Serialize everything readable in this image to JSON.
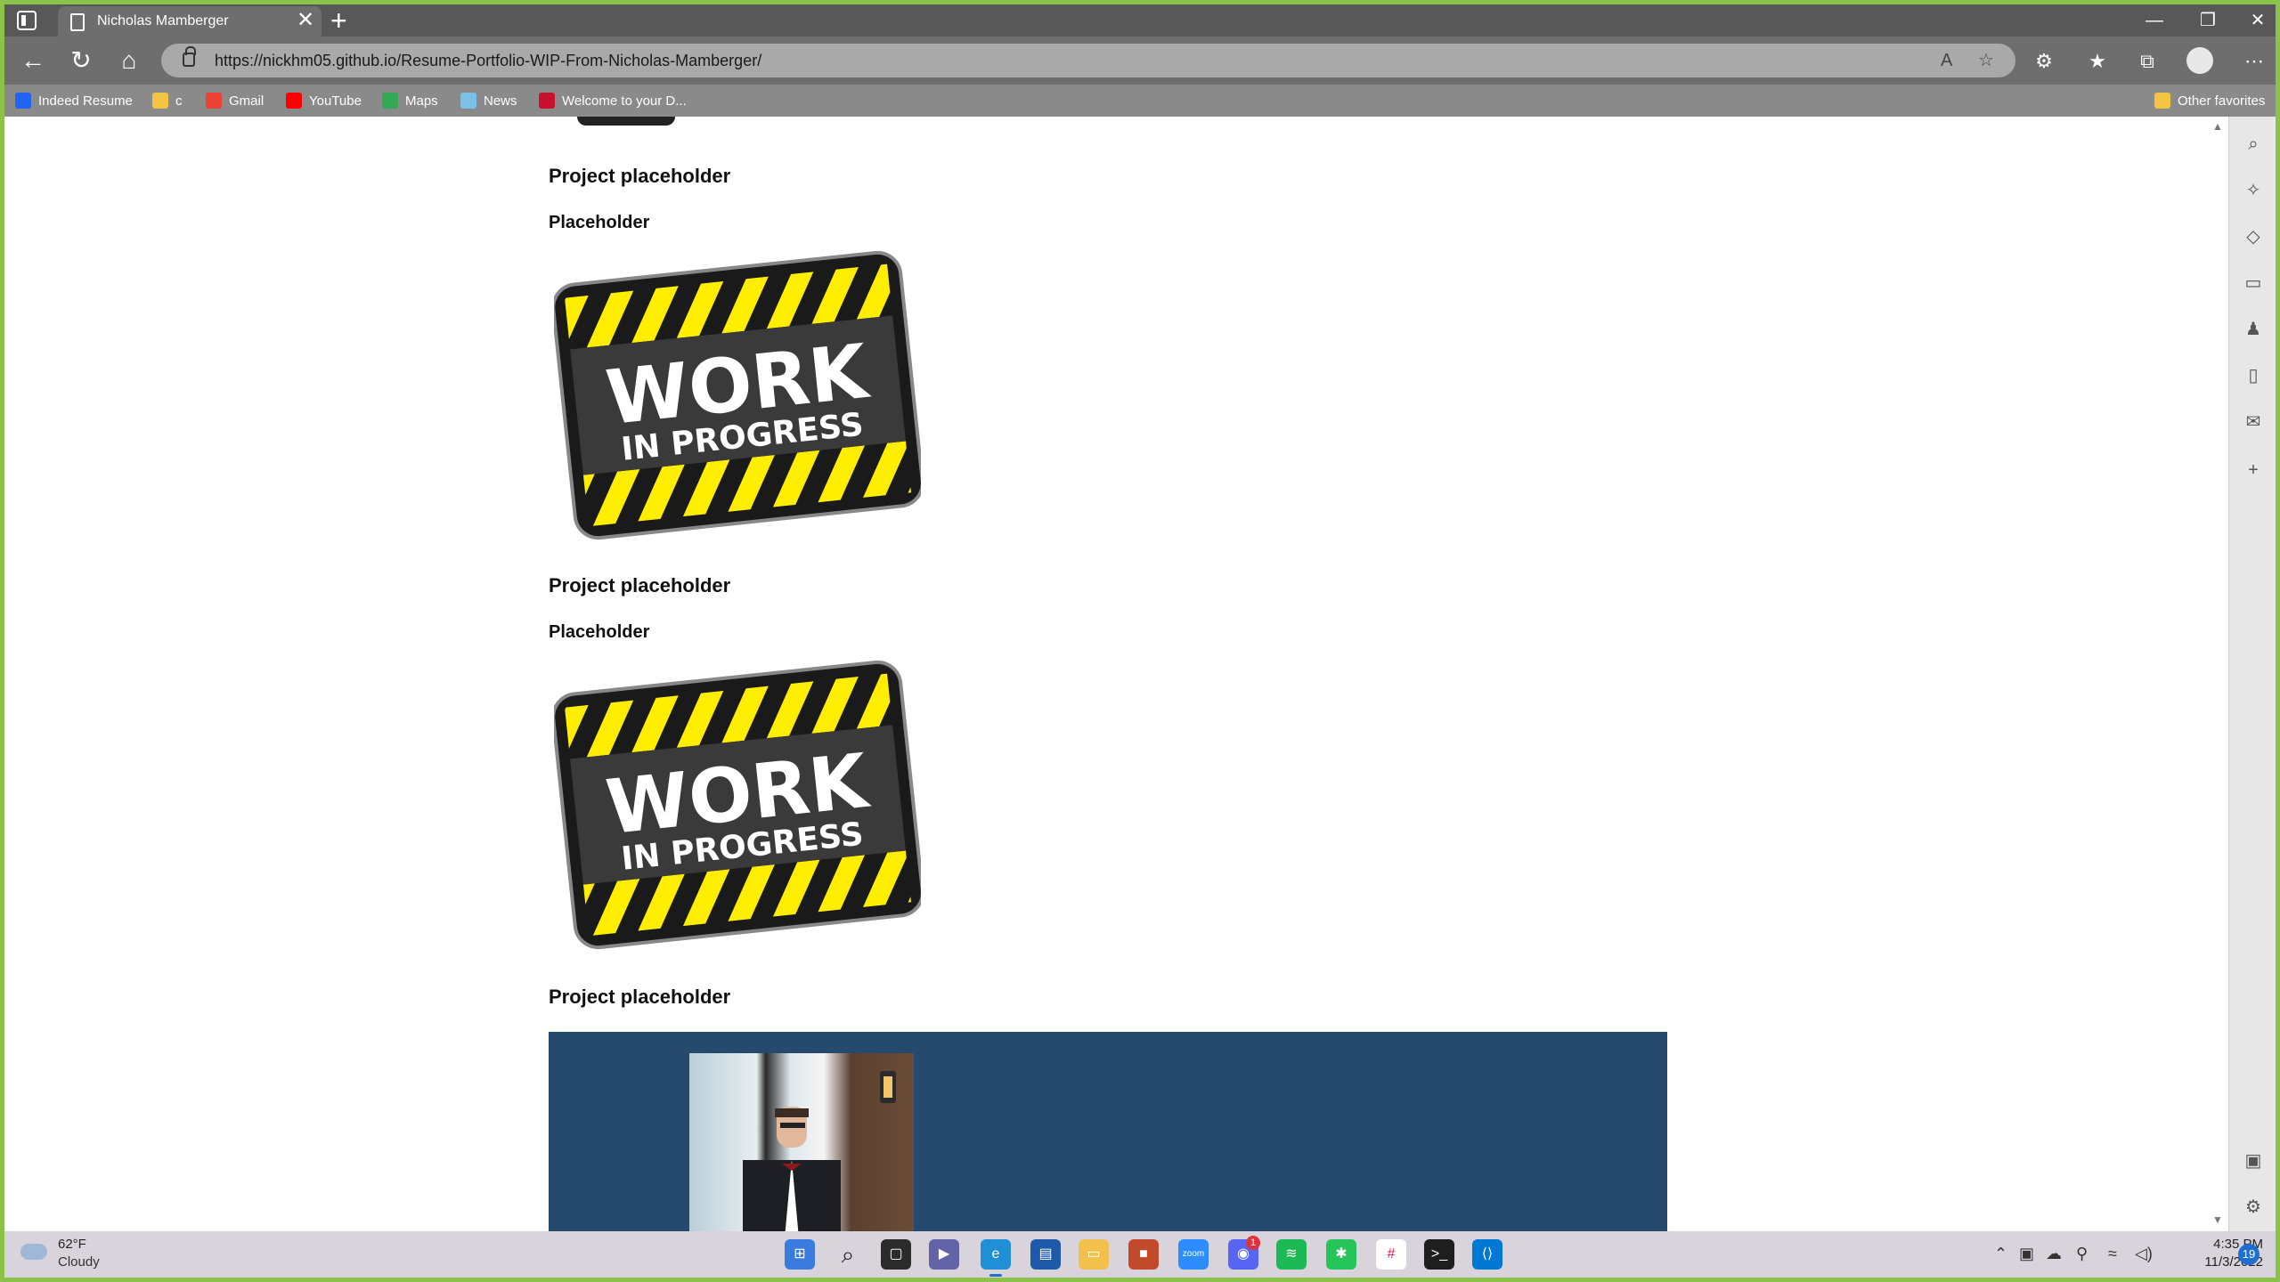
{
  "browser": {
    "tab_title": "Nicholas Mamberger",
    "tab_close": "✕",
    "new_tab": "+",
    "url": "https://nickhm05.github.io/Resume-Portfolio-WIP-From-Nicholas-Mamberger/",
    "window_controls": {
      "minimize": "—",
      "restore": "❐",
      "close": "✕"
    }
  },
  "favorites": [
    {
      "label": "Indeed Resume",
      "color": "#2164f3"
    },
    {
      "label": "c",
      "color": "#f4c542"
    },
    {
      "label": "Gmail",
      "color": "#ea4335"
    },
    {
      "label": "YouTube",
      "color": "#ff0000"
    },
    {
      "label": "Maps",
      "color": "#34a853"
    },
    {
      "label": "News",
      "color": "#7cc0e8"
    },
    {
      "label": "Welcome to your D...",
      "color": "#c8102e"
    }
  ],
  "other_favorites": "Other favorites",
  "page": {
    "sections": [
      {
        "title": "Project placeholder",
        "subtitle": "Placeholder"
      },
      {
        "title": "Project placeholder",
        "subtitle": "Placeholder"
      },
      {
        "title": "Project placeholder"
      }
    ],
    "wip_sign": {
      "line1": "WORK",
      "line2": "IN PROGRESS"
    }
  },
  "taskbar": {
    "weather_temp": "62°F",
    "weather_desc": "Cloudy",
    "time": "4:35 PM",
    "date": "11/3/2022",
    "notifications": "19",
    "discord_badge": "1",
    "zoom_label": "zoom"
  },
  "colors": {
    "hero_bg": "#264a6e",
    "sign_yellow": "#ffee00",
    "sign_black": "#1a1a1a"
  }
}
